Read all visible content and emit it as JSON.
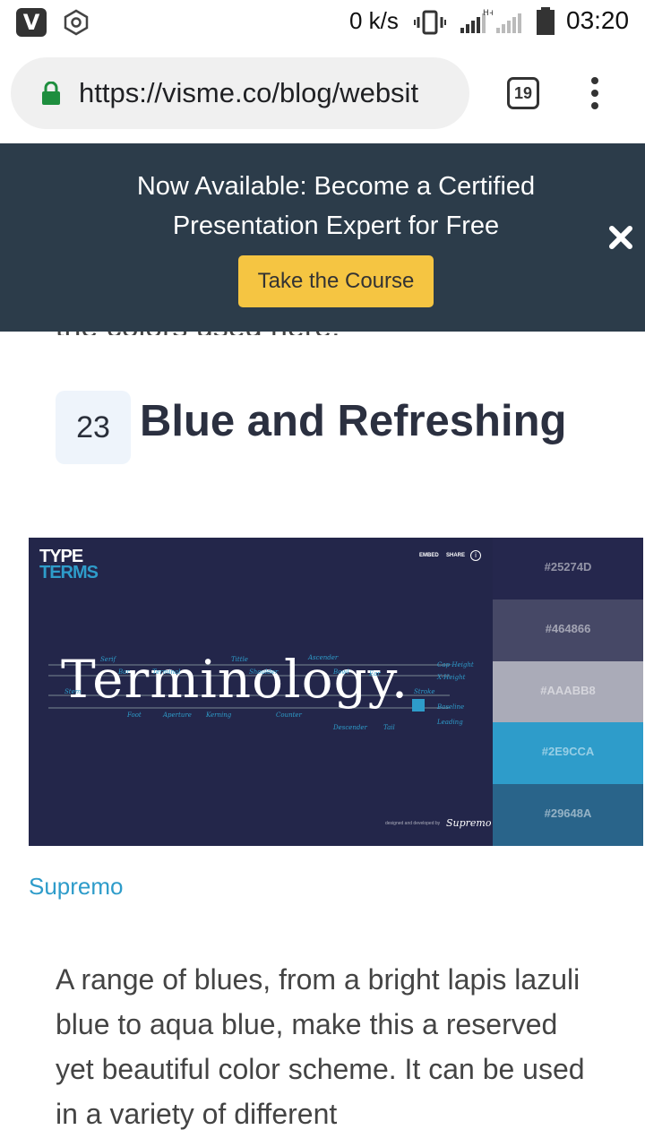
{
  "status_bar": {
    "speed": "0 k/s",
    "time": "03:20",
    "icons": [
      "app-v-icon",
      "hexagon-icon",
      "vibrate-icon",
      "signal-icon",
      "battery-icon"
    ]
  },
  "browser": {
    "url": "https://visme.co/blog/websit",
    "tab_count": "19"
  },
  "banner": {
    "text": "Now Available: Become a Certified Presentation Expert for Free",
    "button_label": "Take the Course",
    "bg_color": "#2c3c4a",
    "button_color": "#f5c542"
  },
  "article": {
    "peek_text": "the colors used here.",
    "section_number": "23",
    "section_title": "Blue and Refreshing",
    "image": {
      "logo_top": "TYPE",
      "logo_bottom": "TERMS",
      "embed": "EMBED",
      "share": "SHARE",
      "headline": "Terminology.",
      "credit": "designed and developed by",
      "credit_brand": "Supremo",
      "terms": [
        "Serif",
        "Bar",
        "Terminal",
        "Tittle",
        "Shoulder",
        "Ascender",
        "Bowl",
        "Ear",
        "Cap-Height",
        "X-Height",
        "Stem",
        "Stroke",
        "Foot",
        "Aperture",
        "Kerning",
        "Counter",
        "Descender",
        "Tail",
        "Baseline",
        "Leading"
      ],
      "swatches": [
        {
          "hex": "#25274D",
          "color": "#25274d"
        },
        {
          "hex": "#464866",
          "color": "#464866"
        },
        {
          "hex": "#AAABB8",
          "color": "#aaabb8"
        },
        {
          "hex": "#2E9CCA",
          "color": "#2e9cca"
        },
        {
          "hex": "#29648A",
          "color": "#29648a"
        }
      ]
    },
    "caption": "Supremo",
    "body": "A range of blues, from a bright lapis lazuli blue to aqua blue, make this a reserved yet beautiful color scheme. It can be used in a variety of different"
  }
}
